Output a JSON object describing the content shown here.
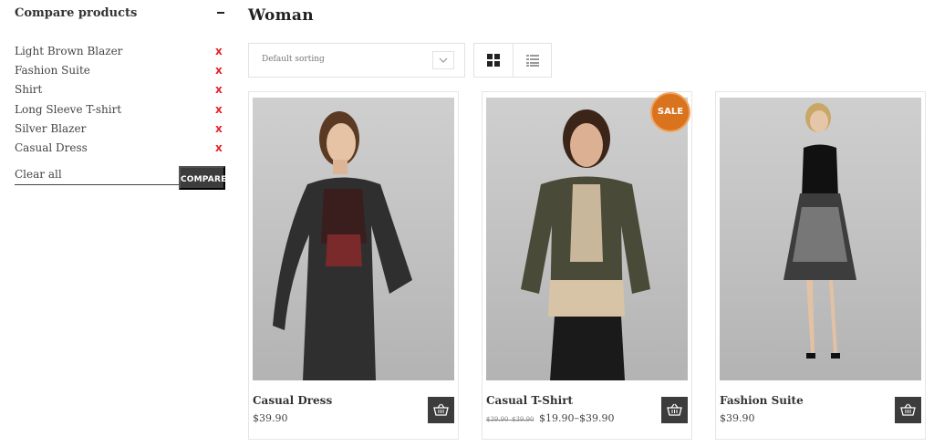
{
  "sidebar": {
    "title": "Compare products",
    "items": [
      {
        "label": "Light Brown Blazer",
        "remove": "x"
      },
      {
        "label": "Fashion Suite",
        "remove": "x"
      },
      {
        "label": "Shirt",
        "remove": "x"
      },
      {
        "label": "Long Sleeve T-shirt",
        "remove": "x"
      },
      {
        "label": "Silver Blazer",
        "remove": "x"
      },
      {
        "label": "Casual Dress",
        "remove": "x"
      }
    ],
    "clear_all": "Clear all",
    "compare_button": "COMPARE"
  },
  "main": {
    "title": "Woman",
    "sorting": {
      "selected": "Default sorting"
    },
    "view_modes": [
      "grid-view-icon",
      "list-view-icon"
    ],
    "products": [
      {
        "name": "Casual Dress",
        "price": "$39.90",
        "old_prices": "",
        "sale": ""
      },
      {
        "name": "Casual T-Shirt",
        "price": "$19.90–$39.90",
        "old_prices": "$39.90–$39.90",
        "sale": "SALE"
      },
      {
        "name": "Fashion Suite",
        "price": "$39.90",
        "old_prices": "",
        "sale": ""
      }
    ]
  },
  "colors": {
    "accent_remove": "#e8202a",
    "sale_badge": "#d9731e",
    "dark_button": "#3c3c3c"
  }
}
